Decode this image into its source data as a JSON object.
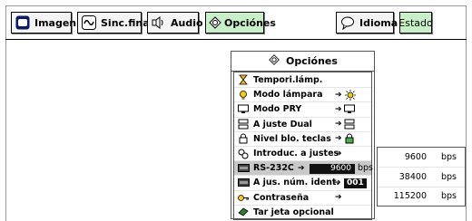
{
  "menu_bar": {
    "imagen": "Imagen",
    "sinc_fina": "Sinc.fina",
    "audio": "Audio",
    "opciones": "Opciónes",
    "idioma": "Idioma",
    "estado": "Estado"
  },
  "options_panel": {
    "title": "Opciónes",
    "items": [
      {
        "label": "Tempori.lámp.",
        "arrow": "",
        "icon": "hourglass-icon"
      },
      {
        "label": "Modo lámpara",
        "arrow": "➔",
        "icon": "lamp-icon"
      },
      {
        "label": "Modo PRY",
        "arrow": "➔",
        "icon": "projector-icon"
      },
      {
        "label": "A juste Dual",
        "arrow": "➔",
        "icon": "dual-setting-icon"
      },
      {
        "label": "Nivel blo. teclas",
        "arrow": "➔",
        "icon": "lock-icon"
      },
      {
        "label": "Introduc. a justes",
        "arrow": "➔",
        "icon": "settings-icon"
      },
      {
        "label": "RS-232C",
        "arrow": "➔",
        "value": "9600",
        "unit": "bps",
        "icon": "rs232c-icon",
        "selected": true
      },
      {
        "label": "A jus. núm. ident.",
        "arrow": "➔",
        "value": "001",
        "icon": "id-icon"
      },
      {
        "label": "Contraseña",
        "arrow": "➔",
        "icon": "key-icon"
      },
      {
        "label": "Tar jeta opcional",
        "arrow": "",
        "icon": "card-icon"
      }
    ]
  },
  "baud_submenu": {
    "options": [
      {
        "value": "9600",
        "unit": "bps"
      },
      {
        "value": "38400",
        "unit": "bps"
      },
      {
        "value": "115200",
        "unit": "bps"
      }
    ]
  },
  "colors": {
    "active_tab": "#c8f0c8",
    "selected_row": "#c9c9c9",
    "value_box": "#111111"
  }
}
